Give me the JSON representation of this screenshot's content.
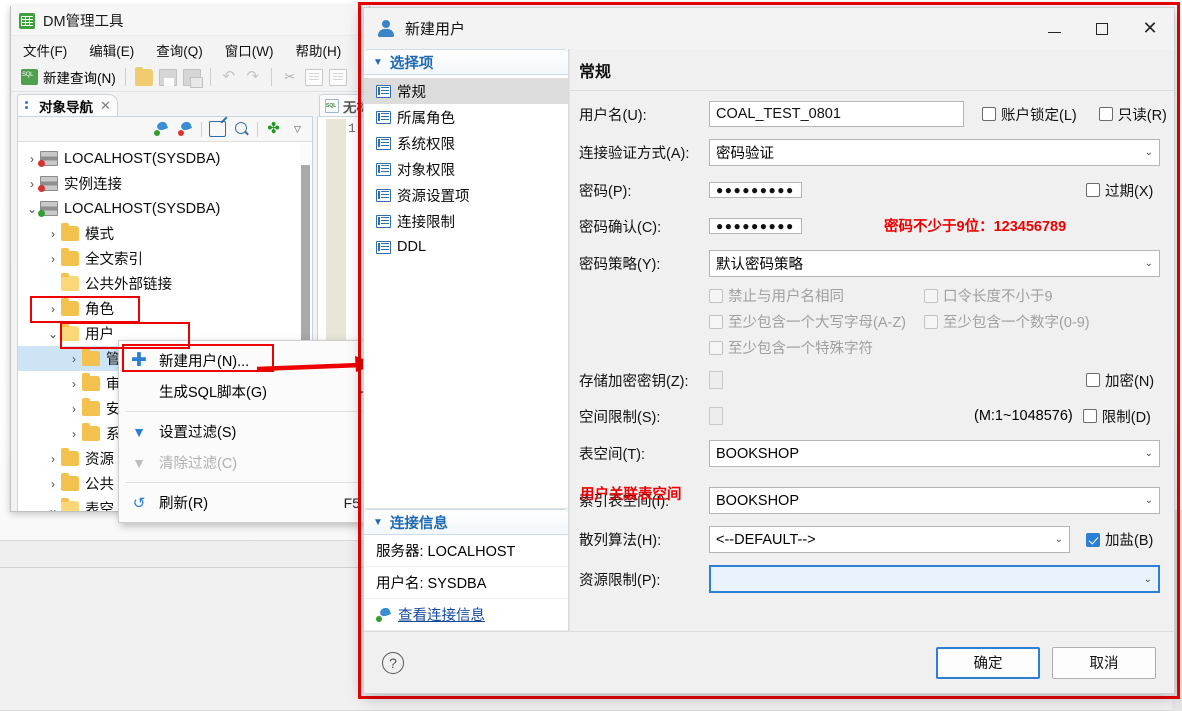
{
  "app": {
    "title": "DM管理工具",
    "icon": "database-grid-icon",
    "menu": [
      {
        "label": "文件(F)"
      },
      {
        "label": "编辑(E)"
      },
      {
        "label": "查询(Q)"
      },
      {
        "label": "窗口(W)"
      },
      {
        "label": "帮助(H)"
      }
    ],
    "toolbar": {
      "new_query": "新建查询(N)",
      "icons": [
        "open-folder-icon",
        "save-icon",
        "save-as-icon",
        "undo-icon",
        "redo-icon",
        "cut-icon",
        "copy-icon",
        "paste-icon"
      ]
    },
    "view_tab": {
      "label": "对象导航",
      "close": "✕"
    },
    "editor_tab": {
      "label": "无标"
    },
    "editor_lineno": "1"
  },
  "navigator": {
    "toolbar_icons": [
      "connect-icon",
      "disconnect-icon",
      "edit-icon",
      "search-icon",
      "collapse-all-icon",
      "view-menu-icon"
    ],
    "tree": [
      {
        "label": "LOCALHOST(SYSDBA)",
        "indent": 0,
        "twisty": "collapsed",
        "icon": "database-icon",
        "status": "#d33333"
      },
      {
        "label": "实例连接",
        "indent": 0,
        "twisty": "collapsed",
        "icon": "database-icon",
        "status": "#d33333"
      },
      {
        "label": "LOCALHOST(SYSDBA)",
        "indent": 0,
        "twisty": "expanded",
        "icon": "database-icon",
        "status": "#2fa02f"
      },
      {
        "label": "模式",
        "indent": 1,
        "twisty": "collapsed",
        "icon": "folder-icon"
      },
      {
        "label": "全文索引",
        "indent": 1,
        "twisty": "collapsed",
        "icon": "folder-icon"
      },
      {
        "label": "公共外部链接",
        "indent": 1,
        "twisty": "none",
        "icon": "folder-open-icon"
      },
      {
        "label": "角色",
        "indent": 1,
        "twisty": "collapsed",
        "icon": "folder-icon"
      },
      {
        "label": "用户",
        "indent": 1,
        "twisty": "expanded",
        "icon": "folder-open-icon"
      },
      {
        "label": "管理用户",
        "indent": 2,
        "twisty": "collapsed",
        "icon": "folder-icon",
        "selected": true
      },
      {
        "label": "审",
        "indent": 2,
        "twisty": "collapsed",
        "icon": "folder-icon"
      },
      {
        "label": "安",
        "indent": 2,
        "twisty": "collapsed",
        "icon": "folder-icon"
      },
      {
        "label": "系",
        "indent": 2,
        "twisty": "collapsed",
        "icon": "folder-icon"
      },
      {
        "label": "资源",
        "indent": 1,
        "twisty": "collapsed",
        "icon": "folder-icon"
      },
      {
        "label": "公共",
        "indent": 1,
        "twisty": "collapsed",
        "icon": "folder-icon"
      },
      {
        "label": "表空",
        "indent": 1,
        "twisty": "expanded",
        "icon": "folder-open-icon"
      }
    ]
  },
  "context_menu": [
    {
      "label": "新建用户(N)...",
      "icon": "plus-icon",
      "enabled": true,
      "accel": ""
    },
    {
      "label": "生成SQL脚本(G)",
      "icon": "",
      "enabled": true,
      "accel": "",
      "submenu": true
    },
    {
      "sep": true
    },
    {
      "label": "设置过滤(S)",
      "icon": "filter-icon",
      "enabled": true,
      "accel": ""
    },
    {
      "label": "清除过滤(C)",
      "icon": "filter-clear-icon",
      "enabled": false,
      "accel": ""
    },
    {
      "sep": true
    },
    {
      "label": "刷新(R)",
      "icon": "refresh-icon",
      "enabled": true,
      "accel": "F5"
    }
  ],
  "dialog": {
    "title": "新建用户",
    "icon": "user-icon",
    "window_buttons": {
      "minimize": "minimize-icon",
      "maximize": "maximize-icon",
      "close": "close-icon"
    },
    "sidebar": {
      "section_title": "选择项",
      "items": [
        {
          "label": "常规",
          "active": true
        },
        {
          "label": "所属角色",
          "active": false
        },
        {
          "label": "系统权限",
          "active": false
        },
        {
          "label": "对象权限",
          "active": false
        },
        {
          "label": "资源设置项",
          "active": false
        },
        {
          "label": "连接限制",
          "active": false
        },
        {
          "label": "DDL",
          "active": false
        }
      ],
      "conn_info": {
        "title": "连接信息",
        "server": "服务器: LOCALHOST",
        "username": "用户名: SYSDBA",
        "link": "查看连接信息"
      }
    },
    "page_title": "常规",
    "fields": {
      "username_label": "用户名(U):",
      "username_value": "COAL_TEST_0801",
      "account_lock_label": "账户锁定(L)",
      "account_lock_checked": false,
      "readonly_label": "只读(R)",
      "readonly_checked": false,
      "auth_label": "连接验证方式(A):",
      "auth_value": "密码验证",
      "password_label": "密码(P):",
      "password_value": "●●●●●●●●●",
      "expired_label": "过期(X)",
      "expired_checked": false,
      "password_confirm_label": "密码确认(C):",
      "password_confirm_value": "●●●●●●●●●",
      "policy_label": "密码策略(Y):",
      "policy_value": "默认密码策略",
      "policy_options": [
        {
          "label": "禁止与用户名相同",
          "checked": false
        },
        {
          "label": "口令长度不小于9",
          "checked": false
        },
        {
          "label": "至少包含一个大写字母(A-Z)",
          "checked": false
        },
        {
          "label": "至少包含一个数字(0-9)",
          "checked": false
        },
        {
          "label": "至少包含一个特殊字符",
          "checked": false
        }
      ],
      "enckey_label": "存储加密密钥(Z):",
      "enckey_value": "",
      "encrypt_label": "加密(N)",
      "encrypt_checked": false,
      "space_label": "空间限制(S):",
      "space_value": "",
      "space_hint": "(M:1~1048576)",
      "space_limit_label": "限制(D)",
      "space_limit_checked": false,
      "tablespace_label": "表空间(T):",
      "tablespace_value": "BOOKSHOP",
      "index_tablespace_label": "索引表空间(I):",
      "index_tablespace_value": "BOOKSHOP",
      "hash_label": "散列算法(H):",
      "hash_value": "<--DEFAULT-->",
      "salt_label": "加盐(B)",
      "salt_checked": true,
      "resource_label": "资源限制(P):",
      "resource_value": ""
    },
    "footer": {
      "help": "?",
      "ok": "确定",
      "cancel": "取消"
    }
  },
  "annotations": {
    "password_note": "密码不少于9位：123456789",
    "tablespace_note": "用户关联表空间",
    "color": "#ee0000"
  }
}
